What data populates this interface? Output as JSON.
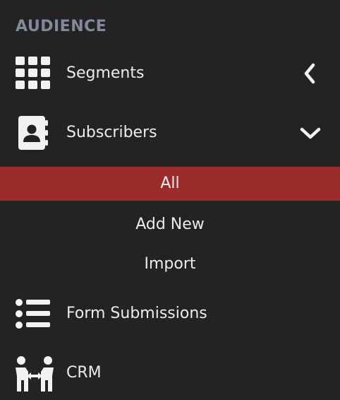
{
  "section_title": "AUDIENCE",
  "menu": {
    "segments": {
      "label": "Segments",
      "icon": "grid-icon",
      "chevron": "chevron-left-icon"
    },
    "subscribers": {
      "label": "Subscribers",
      "icon": "address-book-icon",
      "chevron": "chevron-down-icon",
      "children": [
        {
          "label": "All",
          "active": true
        },
        {
          "label": "Add New",
          "active": false
        },
        {
          "label": "Import",
          "active": false
        }
      ]
    },
    "form_submissions": {
      "label": "Form Submissions",
      "icon": "list-icon"
    },
    "crm": {
      "label": "CRM",
      "icon": "handshake-arrows-icon"
    }
  },
  "colors": {
    "background": "#232323",
    "section_title": "#7f8a9b",
    "active_background": "#9b2c2c",
    "text": "#ececec"
  }
}
